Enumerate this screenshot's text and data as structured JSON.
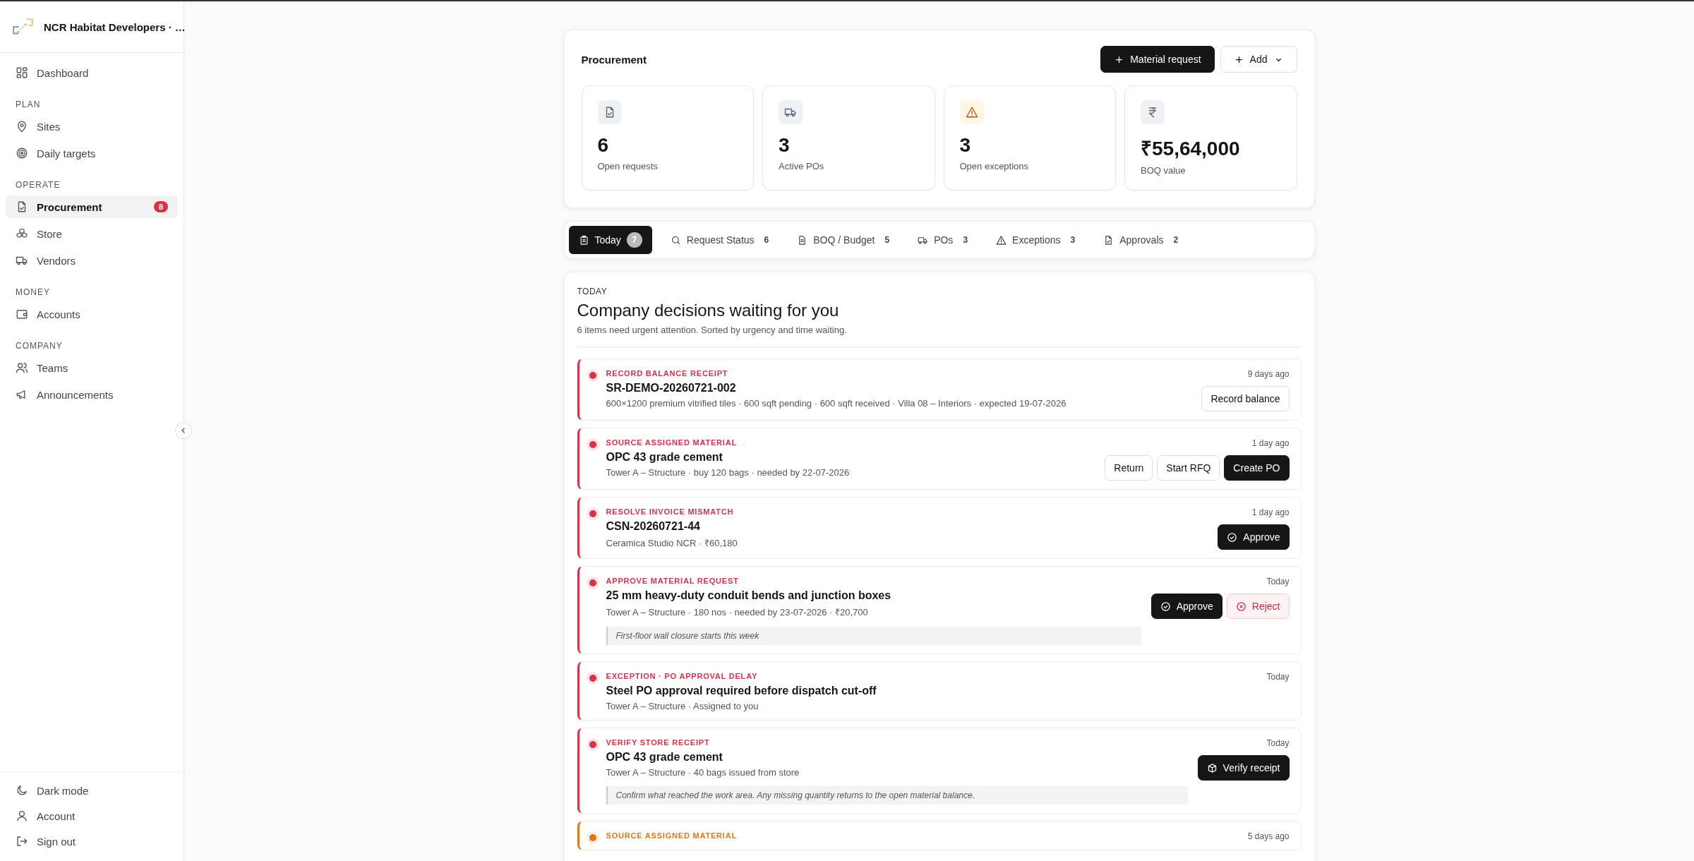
{
  "sidebar": {
    "org_name": "NCR Habitat Developers · …",
    "top_items": [
      {
        "label": "Dashboard",
        "selected": false
      }
    ],
    "sections": [
      {
        "heading": "PLAN",
        "items": [
          {
            "label": "Sites",
            "selected": false
          },
          {
            "label": "Daily targets",
            "selected": false
          }
        ]
      },
      {
        "heading": "OPERATE",
        "items": [
          {
            "label": "Procurement",
            "selected": true,
            "badge": "8"
          },
          {
            "label": "Store",
            "selected": false
          },
          {
            "label": "Vendors",
            "selected": false
          }
        ]
      },
      {
        "heading": "MONEY",
        "items": [
          {
            "label": "Accounts",
            "selected": false
          }
        ]
      },
      {
        "heading": "COMPANY",
        "items": [
          {
            "label": "Teams",
            "selected": false
          },
          {
            "label": "Announcements",
            "selected": false
          }
        ]
      }
    ],
    "footer_items": [
      {
        "label": "Dark mode"
      },
      {
        "label": "Account"
      },
      {
        "label": "Sign out"
      }
    ]
  },
  "header": {
    "title": "Procurement",
    "buttons": [
      {
        "label": "Material request",
        "kind": "primary"
      },
      {
        "label": "Add",
        "kind": "dropdown"
      }
    ]
  },
  "stats": [
    {
      "value": "6",
      "label": "Open requests"
    },
    {
      "value": "3",
      "label": "Active POs"
    },
    {
      "value": "3",
      "label": "Open exceptions"
    },
    {
      "value": "₹55,64,000",
      "label": "BOQ value"
    }
  ],
  "tabs": [
    {
      "label": "Today",
      "count": "7",
      "selected": true
    },
    {
      "label": "Request Status",
      "count": "6",
      "selected": false
    },
    {
      "label": "BOQ / Budget",
      "count": "5",
      "selected": false
    },
    {
      "label": "POs",
      "count": "3",
      "selected": false
    },
    {
      "label": "Exceptions",
      "count": "3",
      "selected": false
    },
    {
      "label": "Approvals",
      "count": "2",
      "selected": false
    }
  ],
  "today": {
    "eyebrow": "TODAY",
    "title": "Company decisions waiting for you",
    "subtitle": "6 items need urgent attention. Sorted by urgency and time waiting.",
    "items": [
      {
        "kicker": "RECORD BALANCE RECEIPT",
        "color": "#d6324a",
        "time": "9 days ago",
        "title": "SR-DEMO-20260721-002",
        "details": "600×1200 premium vitrified tiles · 600 sqft pending · 600 sqft received · Villa 08 – Interiors · expected 19-07-2026",
        "actions": [
          {
            "label": "Record balance",
            "kind": "outline"
          }
        ]
      },
      {
        "kicker": "SOURCE ASSIGNED MATERIAL",
        "color": "#d6324a",
        "time": "1 day ago",
        "title": "OPC 43 grade cement",
        "details": "Tower A – Structure · buy 120 bags · needed by 22-07-2026",
        "actions": [
          {
            "label": "Return",
            "kind": "outline"
          },
          {
            "label": "Start RFQ",
            "kind": "outline"
          },
          {
            "label": "Create PO",
            "kind": "primary"
          }
        ]
      },
      {
        "kicker": "RESOLVE INVOICE MISMATCH",
        "color": "#d6324a",
        "time": "1 day ago",
        "title": "CSN-20260721-44",
        "details": "Ceramica Studio NCR · ₹60,180",
        "actions": [
          {
            "label": "Approve",
            "kind": "primary-check"
          }
        ]
      },
      {
        "kicker": "APPROVE MATERIAL REQUEST",
        "color": "#d6324a",
        "time": "Today",
        "title": "25 mm heavy-duty conduit bends and junction boxes",
        "details": "Tower A – Structure · 180 nos · needed by 23-07-2026 · ₹20,700",
        "note": "First-floor wall closure starts this week",
        "actions": [
          {
            "label": "Approve",
            "kind": "primary-check"
          },
          {
            "label": "Reject",
            "kind": "danger"
          }
        ]
      },
      {
        "kicker": "EXCEPTION · PO APPROVAL DELAY",
        "color": "#d6324a",
        "time": "Today",
        "title": "Steel PO approval required before dispatch cut-off",
        "details": "Tower A – Structure · Assigned to you"
      },
      {
        "kicker": "VERIFY STORE RECEIPT",
        "color": "#d6324a",
        "time": "Today",
        "title": "OPC 43 grade cement",
        "details": "Tower A – Structure · 40 bags issued from store",
        "note": "Confirm what reached the work area. Any missing quantity returns to the open material balance.",
        "actions": [
          {
            "label": "Verify receipt",
            "kind": "primary-box"
          }
        ]
      },
      {
        "kicker": "SOURCE ASSIGNED MATERIAL",
        "color": "#d97a1c",
        "time": "5 days ago"
      }
    ]
  }
}
